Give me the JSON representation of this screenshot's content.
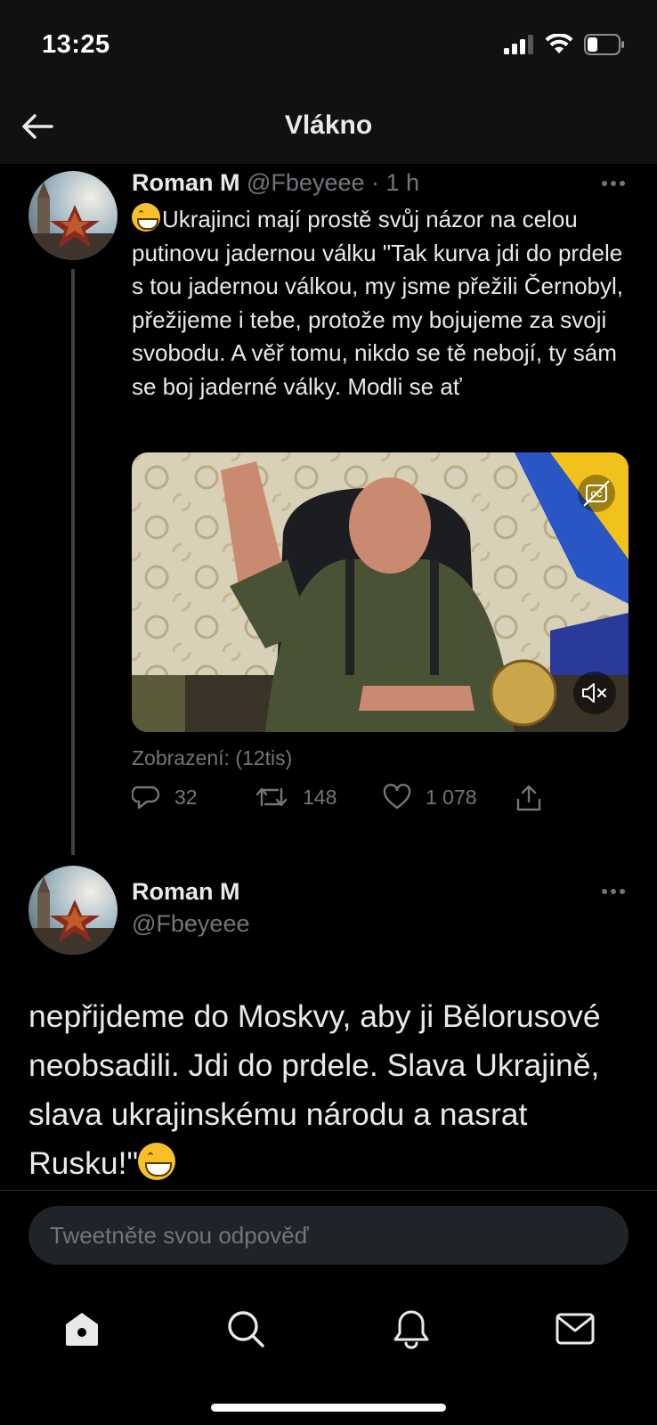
{
  "status_bar": {
    "time": "13:25",
    "icons": [
      "cellular-signal-icon",
      "wifi-icon",
      "battery-icon"
    ]
  },
  "nav": {
    "back_icon": "arrow-left-icon",
    "title": "Vlákno"
  },
  "tweet_1": {
    "name": "Roman M",
    "handle": "@Fbeyeee",
    "time": "· 1 h",
    "text_emoji": "grinning-face-emoji",
    "text": "Ukrajinci mají prostě svůj názor na celou putinovu jadernou válku \"Tak kurva jdi do prdele s tou jadernou válkou, my jsme přežili Černobyl, přežijeme i tebe, protože my bojujeme za svoji svobodu. A věř tomu, nikdo se tě nebojí, ty sám se boj jaderné války. Modli se ať",
    "media": {
      "type": "video",
      "cc_icon": "closed-captions-icon",
      "mute_icon": "speaker-muted-icon"
    },
    "views": "Zobrazení: (12tis)",
    "actions": {
      "replies": "32",
      "retweets": "148",
      "likes": "1 078"
    }
  },
  "tweet_2": {
    "name": "Roman M",
    "handle": "@Fbeyeee",
    "text": "nepřijdeme do Moskvy, aby ji Bělorusové neobsadili. Jdi do prdele. Slava Ukrajině, slava ukrajinskému národu a nasrat Rusku!\"",
    "trailing_emoji": "grinning-face-emoji"
  },
  "reply": {
    "placeholder": "Tweetněte svou odpověď"
  },
  "tab_bar": {
    "tabs": [
      "home-icon",
      "search-icon",
      "notifications-bell-icon",
      "messages-envelope-icon"
    ]
  },
  "colors": {
    "background": "#000000",
    "text_primary": "#e7e9ea",
    "text_secondary": "#71767b",
    "input_background": "#202327"
  }
}
